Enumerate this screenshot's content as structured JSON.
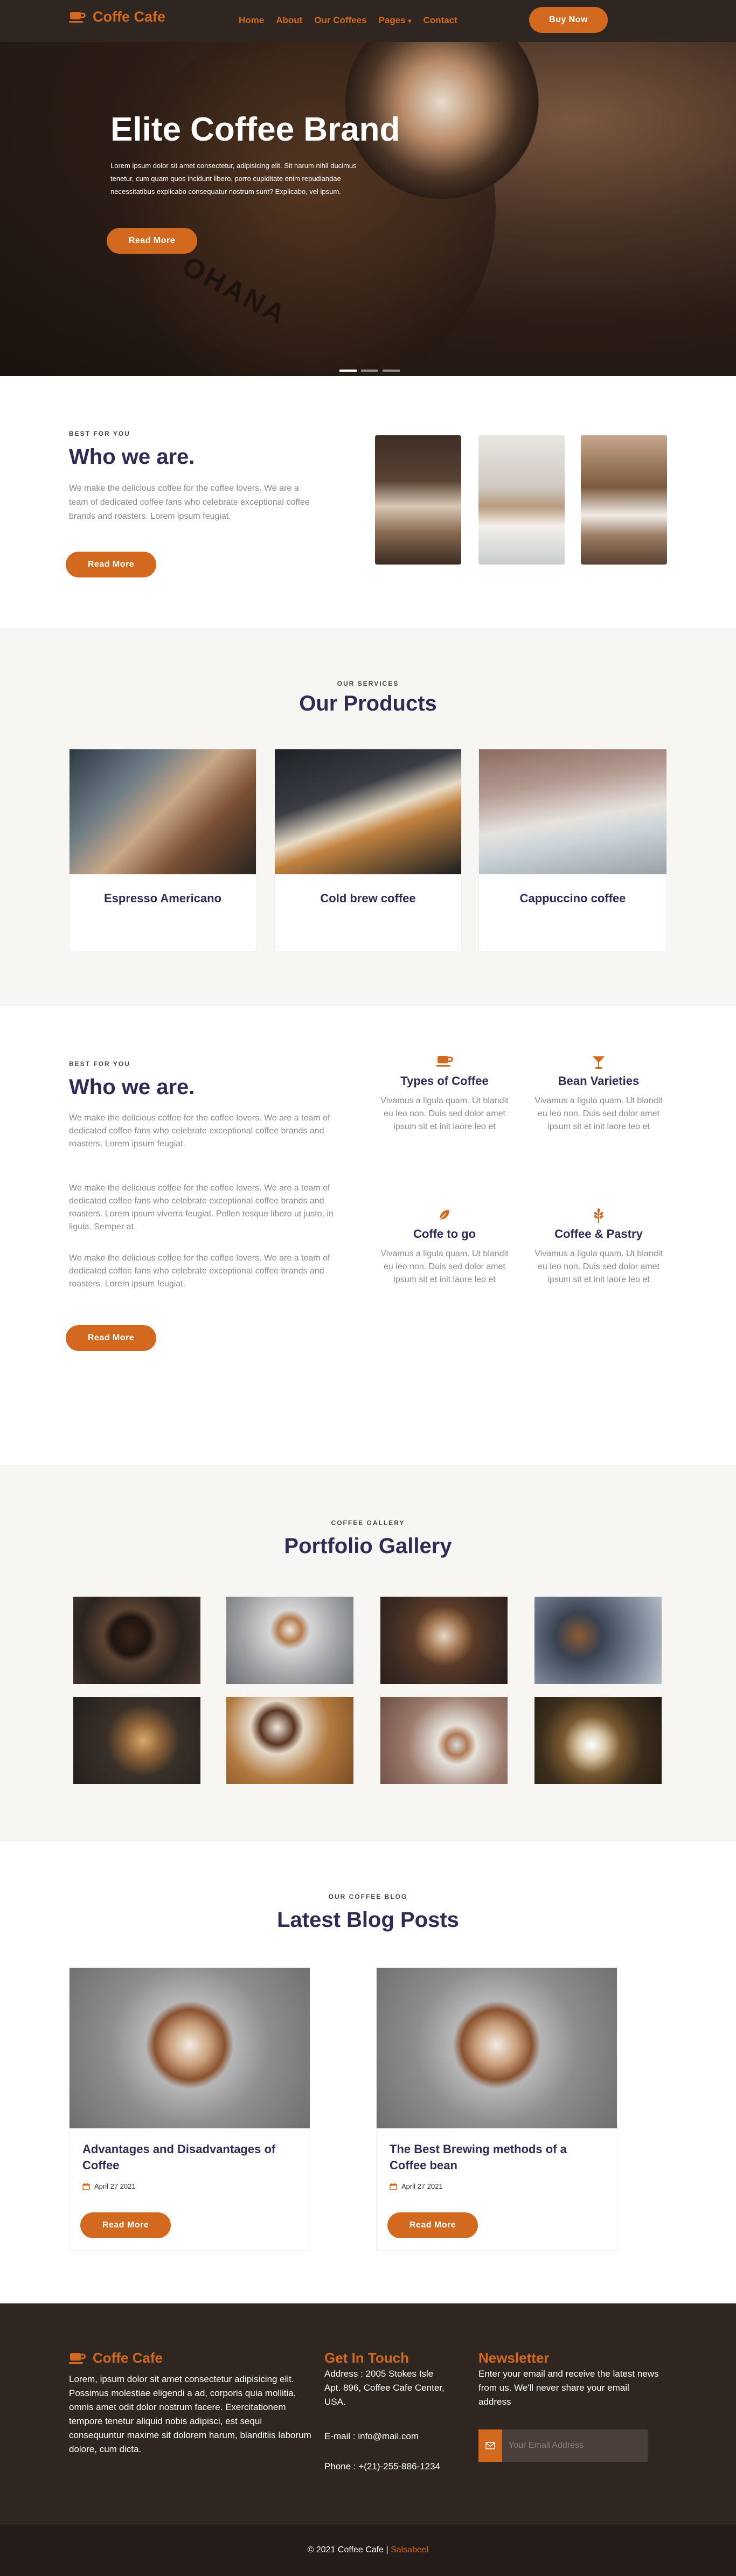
{
  "brand": {
    "name": "Coffe Cafe"
  },
  "nav": {
    "items": [
      "Home",
      "About",
      "Our Coffees",
      "Pages",
      "Contact"
    ],
    "pages_caret": "▾",
    "buy": "Buy Now"
  },
  "hero": {
    "title": "Elite Coffee Brand",
    "text": "Lorem ipsum dolor sit amet consectetur, adipisicing elit. Sit harum nihil ducimus tenetur, cum quam quos incidunt libero, porro cupiditate enim repudiandae necessitatibus explicabo consequatur nostrum sunt? Explicabo, vel ipsum.",
    "button": "Read More",
    "plate_text": "OHANA",
    "slides": 3,
    "active_slide": 0
  },
  "who1": {
    "kicker": "BEST FOR YOU",
    "title": "Who we are.",
    "text": "We make the delicious coffee for the coffee lovers. We are a team of dedicated coffee fans who celebrate exceptional coffee brands and roasters. Lorem ipsum feugiat.",
    "button": "Read More"
  },
  "products": {
    "kicker": "OUR SERVICES",
    "title": "Our Products",
    "items": [
      {
        "name": "Espresso Americano"
      },
      {
        "name": "Cold brew coffee"
      },
      {
        "name": "Cappuccino coffee"
      }
    ]
  },
  "who2": {
    "kicker": "BEST FOR YOU",
    "title": "Who we are.",
    "p1": "We make the delicious coffee for the coffee lovers. We are a team of dedicated coffee fans who celebrate exceptional coffee brands and roasters. Lorem ipsum feugiat.",
    "p2": "We make the delicious coffee for the coffee lovers. We are a team of dedicated coffee fans who celebrate exceptional coffee brands and roasters. Lorem ipsum viverra feugiat. Pellen tesque libero ut justo, in ligula. Semper at.",
    "p3": "We make the delicious coffee for the coffee lovers. We are a team of dedicated coffee fans who celebrate exceptional coffee brands and roasters. Lorem ipsum feugiat.",
    "button": "Read More",
    "features": [
      {
        "icon": "coffee-cup-icon",
        "title": "Types of Coffee",
        "text": "Vivamus a ligula quam. Ut blandit eu leo non. Duis sed dolor amet ipsum sit et init laore leo et"
      },
      {
        "icon": "cocktail-glass-icon",
        "title": "Bean Varieties",
        "text": "Vivamus a ligula quam. Ut blandit eu leo non. Duis sed dolor amet ipsum sit et init laore leo et"
      },
      {
        "icon": "leaf-icon",
        "title": "Coffe to go",
        "text": "Vivamus a ligula quam. Ut blandit eu leo non. Duis sed dolor amet ipsum sit et init laore leo et"
      },
      {
        "icon": "wheat-icon",
        "title": "Coffee & Pastry",
        "text": "Vivamus a ligula quam. Ut blandit eu leo non. Duis sed dolor amet ipsum sit et init laore leo et"
      }
    ]
  },
  "gallery": {
    "kicker": "COFFEE GALLERY",
    "title": "Portfolio Gallery",
    "count": 8
  },
  "blog": {
    "kicker": "OUR COFFEE BLOG",
    "title": "Latest Blog Posts",
    "posts": [
      {
        "title": "Advantages and Disadvantages of Coffee",
        "date": "April 27 2021",
        "button": "Read More"
      },
      {
        "title": "The Best Brewing methods of a Coffee bean",
        "date": "April 27 2021",
        "button": "Read More"
      }
    ]
  },
  "footer": {
    "about": "Lorem, ipsum dolor sit amet consectetur adipisicing elit. Possimus molestiae eligendi a ad, corporis quia mollitia, omnis amet odit dolor nostrum facere. Exercitationem tempore tenetur aliquid nobis adipisci, est sequi consequuntur maxime sit dolorem harum, blanditiis laborum dolore, cum dicta.",
    "touch_title": "Get In Touch",
    "address": "Address : 2005 Stokes Isle Apt. 896, Coffee Cafe Center, USA.",
    "email": "E-mail : info@mail.com",
    "phone": "Phone : +(21)-255-886-1234",
    "newsletter_title": "Newsletter",
    "newsletter_text": "Enter your email and receive the latest news from us. We'll never share your email address",
    "email_placeholder": "Your Email Address",
    "copyright": "© 2021 Coffee Cafe |",
    "author": "Salsabeel"
  },
  "colors": {
    "accent": "#d2691e",
    "dark": "#2f2622",
    "heading": "#2e2b55",
    "light_bg": "#f8f6f2"
  }
}
